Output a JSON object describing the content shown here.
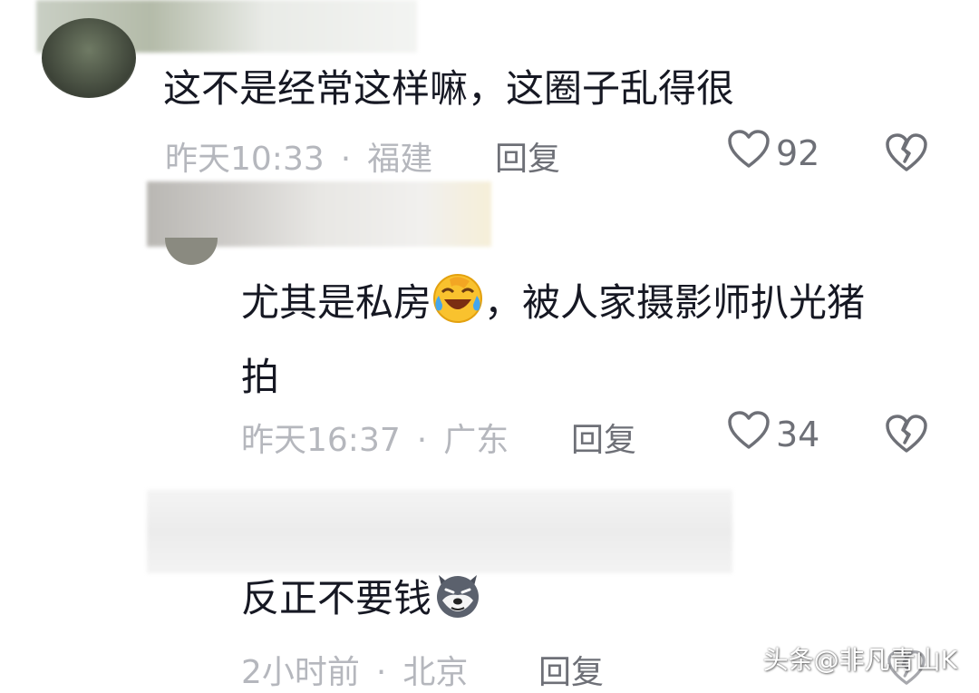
{
  "comments": [
    {
      "text": "这不是经常这样嘛，这圈子乱得很",
      "time": "昨天10:33",
      "location": "福建",
      "reply_label": "回复",
      "likes": "92"
    },
    {
      "text_before_emoji": "尤其是私房",
      "text_after_emoji": "，被人家摄影师扒光猪",
      "text_line2": "拍",
      "emoji": "laughing-tears-emoji",
      "time": "昨天16:37",
      "location": "广东",
      "reply_label": "回复",
      "likes": "34"
    },
    {
      "text": "反正不要钱",
      "emoji": "dog-face-emoji",
      "time": "2小时前",
      "location": "北京",
      "reply_label": "回复"
    }
  ],
  "separator": "·",
  "watermark": "头条@非凡青山K",
  "colors": {
    "text": "#161823",
    "meta": "#b5b7bd",
    "action": "#6e7077"
  }
}
